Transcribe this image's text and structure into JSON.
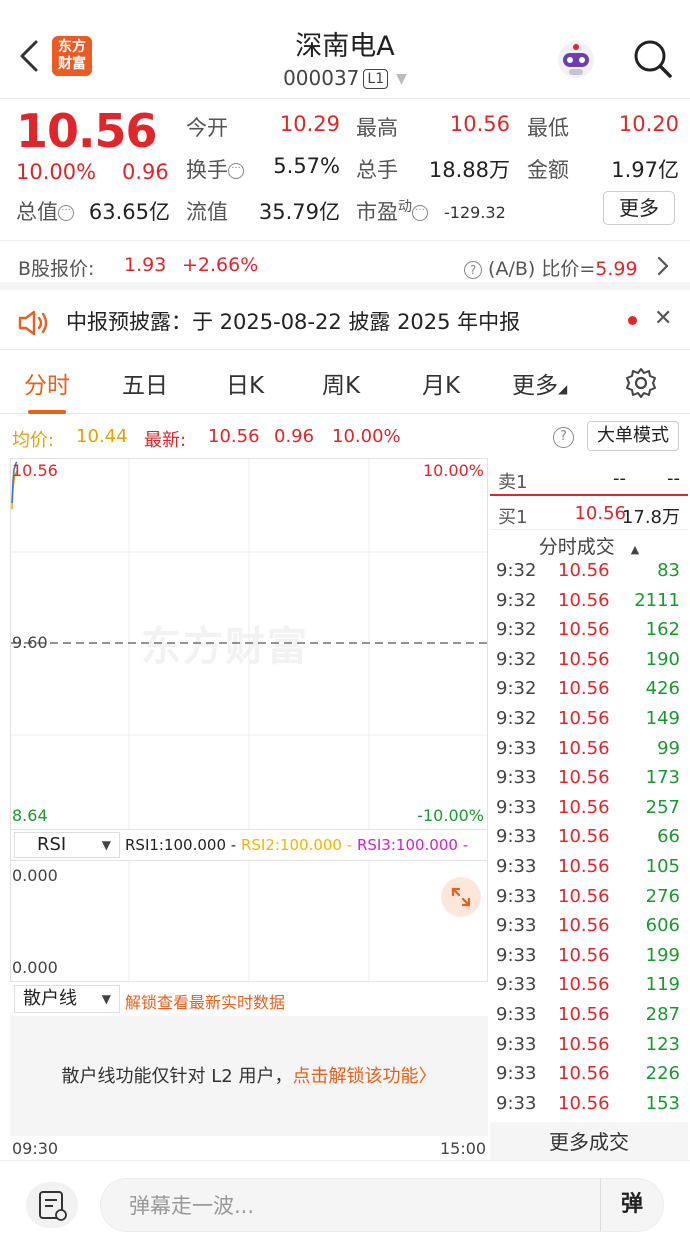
{
  "header": {
    "title": "深南电A",
    "code": "000037",
    "level_badge": "L1",
    "logo_text": "东方\n财富"
  },
  "quote": {
    "price": "10.56",
    "change_pct": "10.00%",
    "change_abs": "0.96",
    "fields": [
      {
        "label": "今开",
        "value": "10.29",
        "color": "red"
      },
      {
        "label": "最高",
        "value": "10.56",
        "color": "red"
      },
      {
        "label": "最低",
        "value": "10.20",
        "color": "red"
      },
      {
        "label": "换手",
        "value": "5.57%",
        "color": "black"
      },
      {
        "label": "总手",
        "value": "18.88万",
        "color": "black"
      },
      {
        "label": "金额",
        "value": "1.97亿",
        "color": "black"
      },
      {
        "label": "总值",
        "value": "63.65亿",
        "color": "black"
      },
      {
        "label": "流值",
        "value": "35.79亿",
        "color": "black"
      },
      {
        "label": "市盈",
        "sup": "动",
        "value": "-129.32",
        "color": "black"
      }
    ],
    "more_label": "更多"
  },
  "bshare": {
    "label": "B股报价:",
    "price": "1.93",
    "pct": "+2.66%",
    "ratio_label": "(A/B) 比价=",
    "ratio_value": "5.99"
  },
  "notice": {
    "text": "中报预披露：于 2025-08-22 披露 2025 年中报"
  },
  "tabs": [
    "分时",
    "五日",
    "日K",
    "周K",
    "月K",
    "更多"
  ],
  "stats": {
    "avg_label": "均价:",
    "avg_value": "10.44",
    "last_label": "最新:",
    "last_value": "10.56",
    "last_change": "0.96",
    "last_pct": "10.00%",
    "mode_button": "大单模式"
  },
  "chart": {
    "watermark": "东方财富",
    "y_top": "10.56",
    "y_mid": "9.60",
    "y_bottom": "8.64",
    "pct_top": "10.00%",
    "pct_bottom": "-10.00%",
    "time_start": "09:30",
    "time_end": "15:00"
  },
  "rsi": {
    "select": "RSI",
    "rsi1": "RSI1:100.000 -",
    "rsi2": "RSI2:100.000 -",
    "rsi3": "RSI3:100.000 -",
    "y_top": "0.000",
    "y_bottom": "0.000",
    "colors": {
      "rsi1": "#222222",
      "rsi2": "#f4b400",
      "rsi3": "#d020d0"
    }
  },
  "retail": {
    "select": "散户线",
    "unlock": "解锁查看最新实时数据",
    "msg": "散户线功能仅针对 L2 用户，",
    "msg_link": "点击解锁该功能〉"
  },
  "orderbook": {
    "sell_label": "卖1",
    "sell_price": "--",
    "sell_vol": "--",
    "buy_label": "买1",
    "buy_price": "10.56",
    "buy_vol": "17.8万",
    "ticks_header": "分时成交",
    "ticks": [
      {
        "t": "9:32",
        "p": "10.56",
        "v": "83"
      },
      {
        "t": "9:32",
        "p": "10.56",
        "v": "2111"
      },
      {
        "t": "9:32",
        "p": "10.56",
        "v": "162"
      },
      {
        "t": "9:32",
        "p": "10.56",
        "v": "190"
      },
      {
        "t": "9:32",
        "p": "10.56",
        "v": "426"
      },
      {
        "t": "9:32",
        "p": "10.56",
        "v": "149"
      },
      {
        "t": "9:33",
        "p": "10.56",
        "v": "99"
      },
      {
        "t": "9:33",
        "p": "10.56",
        "v": "173"
      },
      {
        "t": "9:33",
        "p": "10.56",
        "v": "257"
      },
      {
        "t": "9:33",
        "p": "10.56",
        "v": "66"
      },
      {
        "t": "9:33",
        "p": "10.56",
        "v": "105"
      },
      {
        "t": "9:33",
        "p": "10.56",
        "v": "276"
      },
      {
        "t": "9:33",
        "p": "10.56",
        "v": "606"
      },
      {
        "t": "9:33",
        "p": "10.56",
        "v": "199"
      },
      {
        "t": "9:33",
        "p": "10.56",
        "v": "119"
      },
      {
        "t": "9:33",
        "p": "10.56",
        "v": "287"
      },
      {
        "t": "9:33",
        "p": "10.56",
        "v": "123"
      },
      {
        "t": "9:33",
        "p": "10.56",
        "v": "226"
      },
      {
        "t": "9:33",
        "p": "10.56",
        "v": "153"
      }
    ],
    "more_trades": "更多成交"
  },
  "bottom": {
    "placeholder": "弹幕走一波...",
    "danmu_btn": "弹"
  },
  "colors": {
    "up_red": "#e0262a",
    "down_green": "#1a9a2e",
    "brand_orange": "#e8601c",
    "avg_yellow": "#e8a100"
  },
  "icons": {
    "back": "chevron-left-icon",
    "robot": "robot-assistant-icon",
    "search": "search-icon",
    "speaker": "speaker-icon",
    "close": "close-icon",
    "settings": "gear-icon",
    "help": "question-circle-icon",
    "expand": "expand-arrows-icon",
    "note": "note-edit-icon"
  }
}
